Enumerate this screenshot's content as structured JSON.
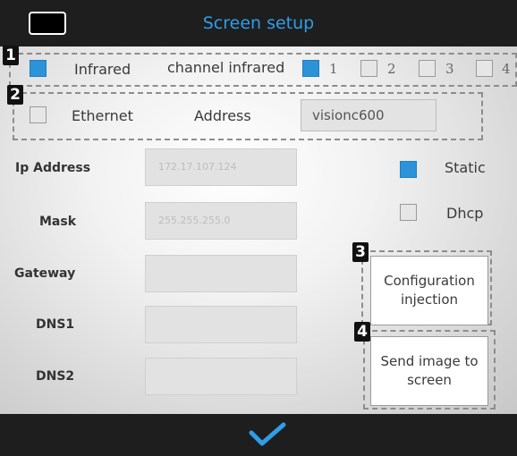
{
  "title": "Screen setup",
  "markers": [
    "1",
    "2",
    "3",
    "4"
  ],
  "infrared": {
    "label": "Infrared",
    "checked": true,
    "channel_label": "channel infrared",
    "channels": [
      {
        "label": "1",
        "checked": true
      },
      {
        "label": "2",
        "checked": false
      },
      {
        "label": "3",
        "checked": false
      },
      {
        "label": "4",
        "checked": false
      }
    ]
  },
  "ethernet": {
    "label": "Ethernet",
    "checked": false,
    "address_label": "Address",
    "address_value": "visionc600"
  },
  "network": {
    "ip_label": "Ip Address",
    "ip_value": "172.17.107.124",
    "mask_label": "Mask",
    "mask_value": "255.255.255.0",
    "gateway_label": "Gateway",
    "gateway_value": "",
    "dns1_label": "DNS1",
    "dns1_value": "",
    "dns2_label": "DNS2",
    "dns2_value": ""
  },
  "mode": {
    "static_label": "Static",
    "static_checked": true,
    "dhcp_label": "Dhcp",
    "dhcp_checked": false
  },
  "buttons": {
    "config_injection": "Configuration injection",
    "send_image": "Send image to screen"
  },
  "icons": {
    "screen": "screen-icon",
    "confirm": "checkmark-icon"
  },
  "colors": {
    "accent": "#2e9ee8",
    "checkbox_on": "#2c93d9",
    "bar": "#1e1e1e"
  }
}
